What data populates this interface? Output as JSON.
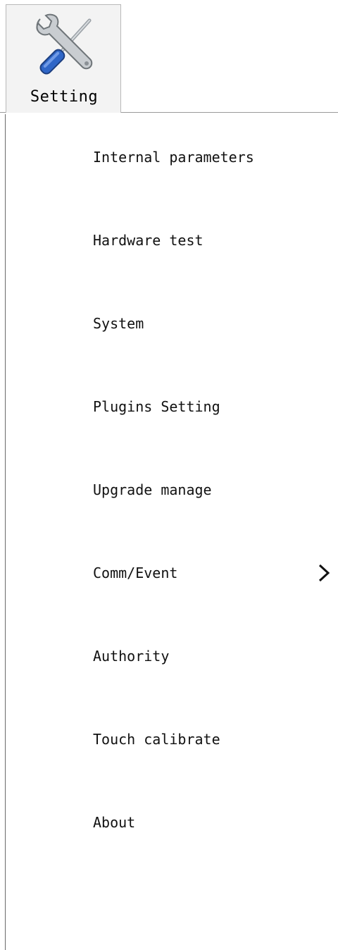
{
  "toolbar": {
    "setting_tab": {
      "label": "Setting",
      "icon": "wrench-screwdriver-icon"
    }
  },
  "menu": {
    "items": [
      {
        "label": "Internal parameters",
        "has_submenu": false
      },
      {
        "label": "Hardware test",
        "has_submenu": false
      },
      {
        "label": "System",
        "has_submenu": false
      },
      {
        "label": "Plugins Setting",
        "has_submenu": false
      },
      {
        "label": "Upgrade manage",
        "has_submenu": false
      },
      {
        "label": "Comm/Event",
        "has_submenu": true,
        "submenu_icon": "chevron-right-icon"
      },
      {
        "label": "Authority",
        "has_submenu": false
      },
      {
        "label": "Touch calibrate",
        "has_submenu": false
      },
      {
        "label": "About",
        "has_submenu": false
      }
    ]
  },
  "colors": {
    "background": "#ffffff",
    "tab_background": "#f3f3f3",
    "border": "#b9b9b9",
    "text": "#111111"
  }
}
